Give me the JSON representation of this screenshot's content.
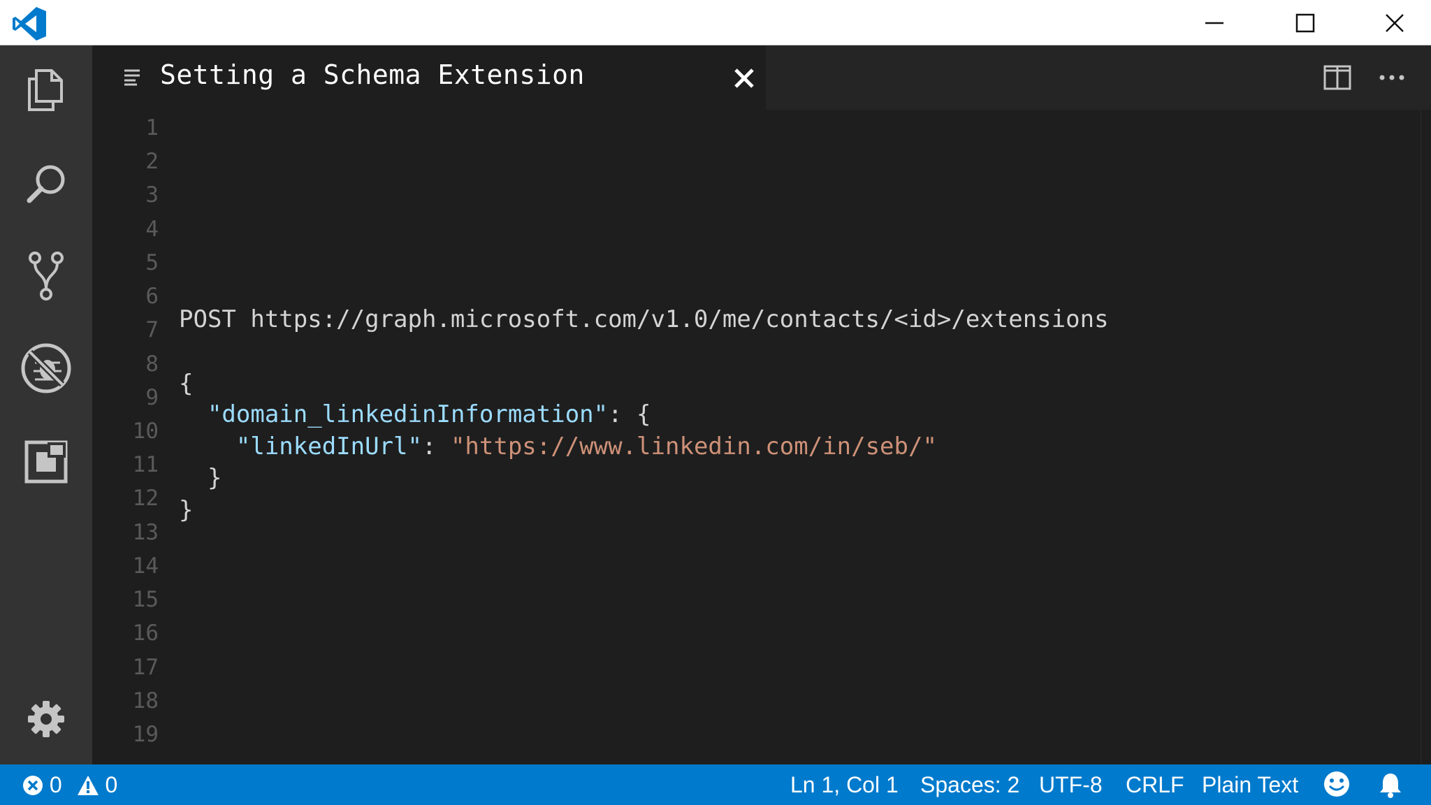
{
  "window": {
    "title": "Setting a Schema Extension"
  },
  "activity_bar": {
    "items": [
      "explorer-icon",
      "search-icon",
      "source-control-icon",
      "debug-icon",
      "extensions-icon"
    ],
    "bottom": "gear-icon"
  },
  "tab": {
    "title": "Setting a Schema Extension",
    "icon": "text-lines-icon"
  },
  "editor": {
    "line_numbers": [
      "1",
      "2",
      "3",
      "4",
      "5",
      "6",
      "7",
      "8",
      "9",
      "10",
      "11",
      "12",
      "13",
      "14",
      "15",
      "16",
      "17",
      "18",
      "19"
    ],
    "lines": {
      "l7": "POST https://graph.microsoft.com/v1.0/me/contacts/<id>/extensions",
      "l8_open": "{",
      "l9_key": "\"domain_linkedinInformation\"",
      "l9_rest": ": {",
      "l10_key": "\"linkedInUrl\"",
      "l10_sep": ": ",
      "l10_val": "\"https://www.linkedin.com/in/seb/\"",
      "l11_close": "}",
      "l12_close": "}"
    }
  },
  "status_bar": {
    "errors": "0",
    "warnings": "0",
    "position": "Ln 1, Col 1",
    "spaces": "Spaces: 2",
    "encoding": "UTF-8",
    "line_ending": "CRLF",
    "language": "Plain Text"
  },
  "colors": {
    "accent": "#007acc",
    "key": "#9cdcfe",
    "string": "#ce9178"
  }
}
